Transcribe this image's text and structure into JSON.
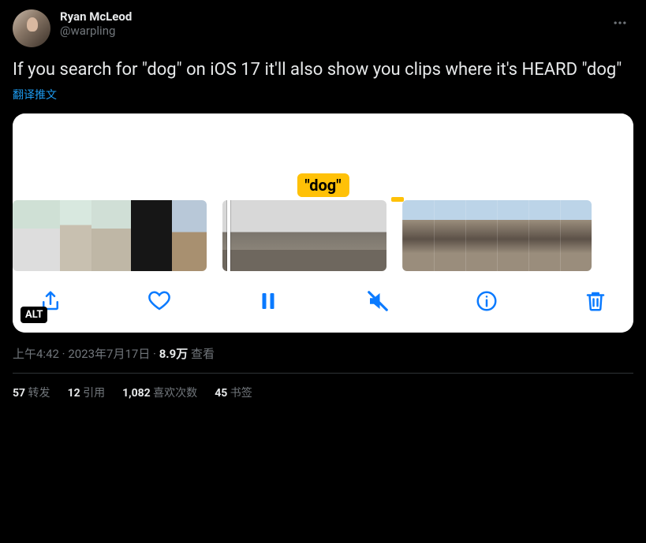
{
  "author": {
    "display_name": "Ryan McLeod",
    "handle": "@warpling"
  },
  "tweet_text": "If you search for \"dog\" on iOS 17 it'll also show you clips where it's HEARD \"dog\"",
  "translate_label": "翻译推文",
  "media": {
    "search_term": "\"dog\"",
    "alt_badge": "ALT",
    "toolbar_icons": [
      "share",
      "heart",
      "pause",
      "mute",
      "info",
      "trash"
    ]
  },
  "meta": {
    "time": "上午4:42",
    "date": "2023年7月17日",
    "separator": " · ",
    "views_count": "8.9万",
    "views_label": " 查看"
  },
  "stats": {
    "retweets": {
      "count": "57",
      "label": " 转发"
    },
    "quotes": {
      "count": "12",
      "label": " 引用"
    },
    "likes": {
      "count": "1,082",
      "label": " 喜欢次数"
    },
    "bookmarks": {
      "count": "45",
      "label": " 书签"
    }
  }
}
